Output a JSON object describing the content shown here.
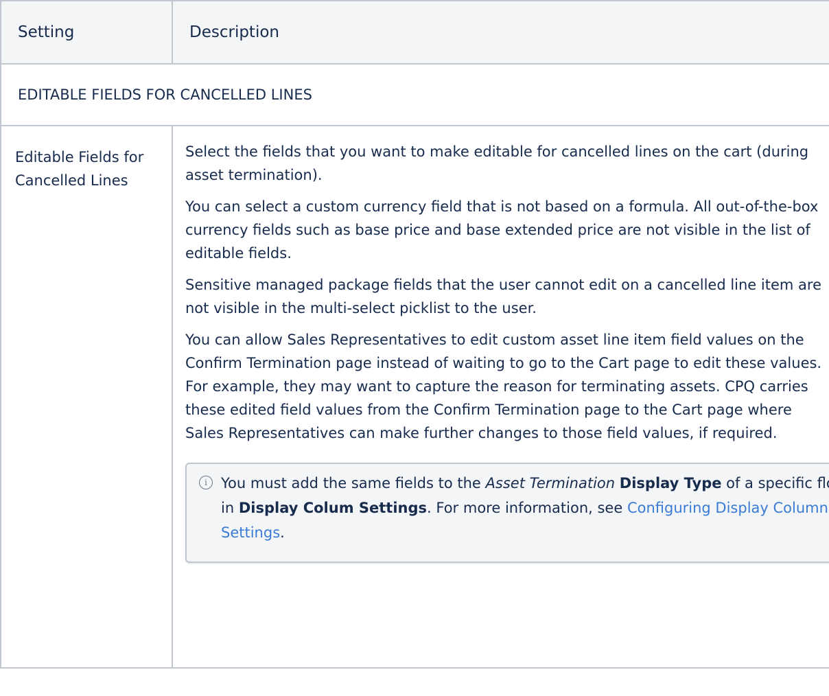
{
  "table": {
    "headers": [
      "Setting",
      "Description"
    ],
    "section_title": "EDITABLE FIELDS FOR CANCELLED LINES",
    "setting_name": "Editable Fields for Cancelled Lines",
    "description_paragraphs": [
      "Select the fields that you want to make editable for cancelled lines on the cart (during asset termination).",
      "You can select a custom currency field that is not based on a formula. All out-of-the-box currency fields such as base price and base extended price are not visible in the list of editable fields.",
      "Sensitive managed package fields that the user cannot edit on a cancelled line item are not visible in the multi-select picklist to the user.",
      "You can allow Sales Representatives to edit custom asset line item field values on the Confirm Termination page instead of waiting to go to the Cart page to edit these values. For example, they may want to capture the reason for terminating assets. CPQ carries these edited field values from the Confirm Termination page to the Cart page where Sales Representatives can make further changes to those field values, if required."
    ],
    "info_panel": {
      "icon": "info-icon",
      "text_1": "You must add the same fields to the ",
      "italic_1": "Asset Termination",
      "text_2": " ",
      "bold_1": "Display Type",
      "text_3": " of a specific flow in ",
      "bold_2": "Display Colum Settings",
      "text_4": ". For more information, see ",
      "link": "Configuring Display Columns Settings",
      "text_5": "."
    }
  },
  "colors": {
    "text": "#172b4d",
    "header_bg": "#f4f5f7",
    "border": "#c1c7d0",
    "link": "#3a7bd5"
  }
}
